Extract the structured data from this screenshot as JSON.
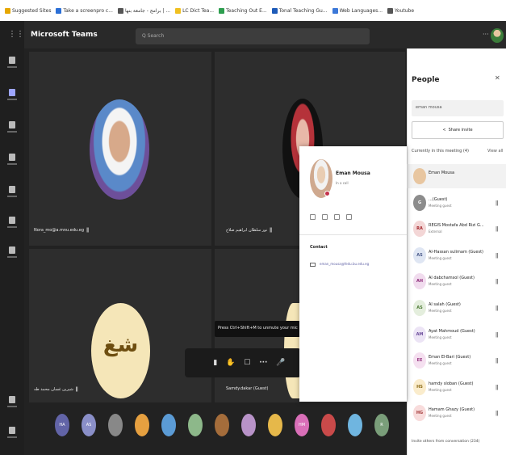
{
  "bookmarks": [
    {
      "label": "Suggested Sites",
      "color": "#e6a700"
    },
    {
      "label": "Take a screenpro c...",
      "color": "#2b6fd6"
    },
    {
      "label": "برامج - جامعة بنها | ...",
      "color": "#555555"
    },
    {
      "label": "LC Dict Tea...",
      "color": "#f0c020"
    },
    {
      "label": "Teaching Out E...",
      "color": "#2e9e4f"
    },
    {
      "label": "Tonal Teaching Gu...",
      "color": "#1e5bb8"
    },
    {
      "label": "Web Languages...",
      "color": "#3c78d8"
    },
    {
      "label": "Youtube",
      "color": "#555555"
    }
  ],
  "app": {
    "title": "Microsoft Teams",
    "search_placeholder": "Q Search",
    "more": "···"
  },
  "tiles": {
    "tile1_name": "Nora_mo@a.mnu.edu.eg",
    "tile2_name": "نور سلطان ابراهيم صلاح",
    "tile3_initials": "شغ",
    "tile3_name": "شيرين غسان محمد طه",
    "tile4_name": "Samdy.dakar (Guest)"
  },
  "tooltip": "Press Ctrl+Shift+M to unmute your mic",
  "toolbar": [
    "▮",
    "✋",
    "☐",
    "···",
    "🎤"
  ],
  "strip": [
    {
      "initials": "HA",
      "color": "#6264a7"
    },
    {
      "initials": "AS",
      "color": "#8a8fc8"
    },
    {
      "initials": "",
      "color": "#888888"
    },
    {
      "initials": "",
      "color": "#e6a040"
    },
    {
      "initials": "",
      "color": "#5b9bd5"
    },
    {
      "initials": "",
      "color": "#8db88a"
    },
    {
      "initials": "",
      "color": "#a56d3b"
    },
    {
      "initials": "",
      "color": "#b893c8"
    },
    {
      "initials": "",
      "color": "#e6b84a"
    },
    {
      "initials": "HM",
      "color": "#d96fb8"
    },
    {
      "initials": "",
      "color": "#c94a4a"
    },
    {
      "initials": "",
      "color": "#6fb5e0"
    },
    {
      "initials": "R",
      "color": "#7a9e7a"
    }
  ],
  "people": {
    "title": "People",
    "search_value": "eman mousa",
    "share_label": "Share invite",
    "section": "Currently in this meeting (4)",
    "view_all": "View all",
    "list": [
      {
        "name": "Eman Mousa",
        "status": "",
        "initials": "",
        "bg": "#e8c6a0",
        "color": "#5a3e2b"
      },
      {
        "name": "...(Guest)",
        "status": "Meeting guest",
        "initials": "G",
        "bg": "#8c8c8c",
        "color": "#ffffff"
      },
      {
        "name": "REGIS Mostafa Abd Rizi G...",
        "status": "External",
        "initials": "RA",
        "bg": "#f3d6d6",
        "color": "#a4262c"
      },
      {
        "name": "Al-Hassan sulimam (Guest)",
        "status": "Meeting guest",
        "initials": "AS",
        "bg": "#dfe6f3",
        "color": "#4a5a8a"
      },
      {
        "name": "Al dabchamsol (Guest)",
        "status": "Meeting guest",
        "initials": "AH",
        "bg": "#f1dcee",
        "color": "#8e2c7a"
      },
      {
        "name": "Al salah (Guest)",
        "status": "Meeting guest",
        "initials": "AS",
        "bg": "#e4eedd",
        "color": "#4d7a35"
      },
      {
        "name": "Ayat Mahmoud (Guest)",
        "status": "Meeting guest",
        "initials": "AM",
        "bg": "#ece4f5",
        "color": "#6b4c9a"
      },
      {
        "name": "Eman El-Bari (Guest)",
        "status": "Meeting guest",
        "initials": "EE",
        "bg": "#f5e0f0",
        "color": "#9a3d86"
      },
      {
        "name": "hamdy sloban (Guest)",
        "status": "Meeting guest",
        "initials": "HS",
        "bg": "#faeccc",
        "color": "#8a6914"
      },
      {
        "name": "Hamam Ghazy (Guest)",
        "status": "Meeting guest",
        "initials": "HG",
        "bg": "#f8dcdc",
        "color": "#a33a3a"
      }
    ],
    "footer": "Invite others from conversation (234)"
  },
  "card": {
    "name": "Eman Mousa",
    "status": "In a call",
    "contact_heading": "Contact",
    "email": "eman_mousa@fedu.bu.edu.eg"
  }
}
